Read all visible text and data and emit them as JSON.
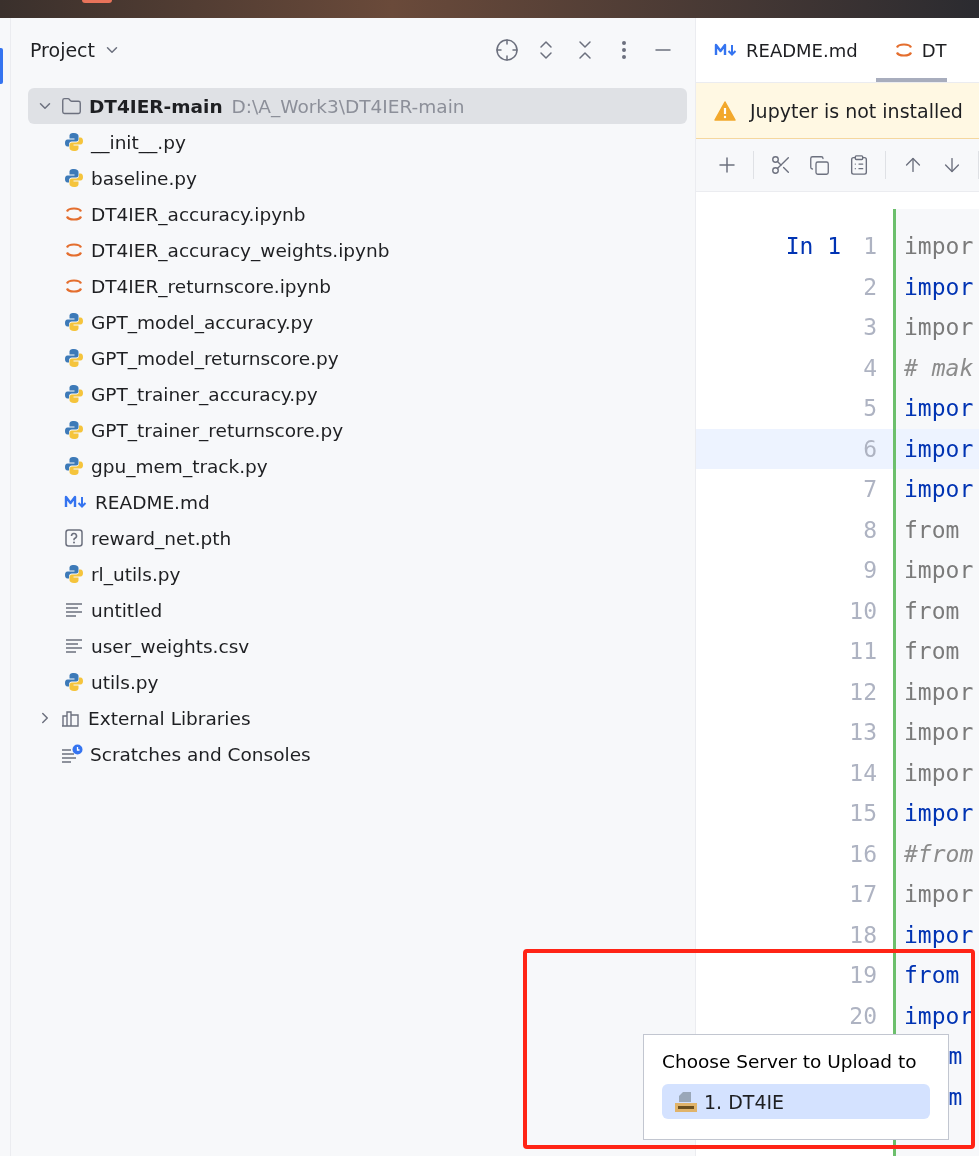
{
  "project_panel": {
    "title": "Project",
    "tree": [
      {
        "name": "DT4IER-main",
        "path": "D:\\A_Work3\\DT4IER-main",
        "kind": "folder",
        "expanded": true,
        "selected": true,
        "children": [
          {
            "name": "__init__.py",
            "kind": "python",
            "selected": false
          },
          {
            "name": "baseline.py",
            "kind": "python",
            "selected": false
          },
          {
            "name": "DT4IER_accuracy.ipynb",
            "kind": "jupyter",
            "selected": false
          },
          {
            "name": "DT4IER_accuracy_weights.ipynb",
            "kind": "jupyter",
            "selected": false
          },
          {
            "name": "DT4IER_returnscore.ipynb",
            "kind": "jupyter",
            "selected": false
          },
          {
            "name": "GPT_model_accuracy.py",
            "kind": "python",
            "selected": false
          },
          {
            "name": "GPT_model_returnscore.py",
            "kind": "python",
            "selected": false
          },
          {
            "name": "GPT_trainer_accuracy.py",
            "kind": "python",
            "selected": false
          },
          {
            "name": "GPT_trainer_returnscore.py",
            "kind": "python",
            "selected": false
          },
          {
            "name": "gpu_mem_track.py",
            "kind": "python",
            "selected": false
          },
          {
            "name": "README.md",
            "kind": "markdown",
            "selected": false
          },
          {
            "name": "reward_net.pth",
            "kind": "unknown",
            "selected": false
          },
          {
            "name": "rl_utils.py",
            "kind": "python",
            "selected": false
          },
          {
            "name": "untitled",
            "kind": "text",
            "selected": false
          },
          {
            "name": "user_weights.csv",
            "kind": "text",
            "selected": false
          },
          {
            "name": "utils.py",
            "kind": "python",
            "selected": false
          }
        ]
      },
      {
        "name": "External Libraries",
        "kind": "libraries",
        "expanded": false,
        "selected": false
      },
      {
        "name": "Scratches and Consoles",
        "kind": "scratches",
        "selected": false
      }
    ]
  },
  "editor": {
    "tabs": [
      {
        "label": "README.md",
        "kind": "markdown",
        "selected": false
      },
      {
        "label": "DT",
        "kind": "jupyter",
        "selected": true
      }
    ],
    "banner": {
      "message": "Jupyter is not installed"
    },
    "cell_label": "In 1",
    "lines": [
      {
        "number": "1",
        "code": "impor",
        "kind": "dimmed",
        "current": false
      },
      {
        "number": "2",
        "code": "impor",
        "kind": "keyword",
        "current": false
      },
      {
        "number": "3",
        "code": "impor",
        "kind": "dimmed",
        "current": false
      },
      {
        "number": "4",
        "code": "# mak",
        "kind": "comment",
        "current": false
      },
      {
        "number": "5",
        "code": "impor",
        "kind": "keyword",
        "current": false
      },
      {
        "number": "6",
        "code": "impor",
        "kind": "keyword",
        "current": true
      },
      {
        "number": "7",
        "code": "impor",
        "kind": "keyword",
        "current": false
      },
      {
        "number": "8",
        "code": "from",
        "kind": "dimmed",
        "current": false
      },
      {
        "number": "9",
        "code": "impor",
        "kind": "dimmed",
        "current": false
      },
      {
        "number": "10",
        "code": "from",
        "kind": "dimmed",
        "current": false
      },
      {
        "number": "11",
        "code": "from",
        "kind": "dimmed",
        "current": false
      },
      {
        "number": "12",
        "code": "impor",
        "kind": "dimmed",
        "current": false
      },
      {
        "number": "13",
        "code": "impor",
        "kind": "dimmed",
        "current": false
      },
      {
        "number": "14",
        "code": "impor",
        "kind": "dimmed",
        "current": false
      },
      {
        "number": "15",
        "code": "impor",
        "kind": "keyword",
        "current": false
      },
      {
        "number": "16",
        "code": "#from",
        "kind": "comment",
        "current": false
      },
      {
        "number": "17",
        "code": "impor",
        "kind": "dimmed",
        "current": false
      },
      {
        "number": "18",
        "code": "impor",
        "kind": "keyword",
        "current": false
      },
      {
        "number": "19",
        "code": "from",
        "kind": "keyword",
        "current": false
      },
      {
        "number": "20",
        "code": "impor",
        "kind": "keyword",
        "current": false
      },
      {
        "code": "m",
        "kind": "keyword"
      },
      {
        "code": "m",
        "kind": "keyword"
      }
    ]
  },
  "upload_popup": {
    "title": "Choose Server to Upload to",
    "servers": [
      {
        "label": "1. DT4IE",
        "selected": true
      }
    ]
  }
}
